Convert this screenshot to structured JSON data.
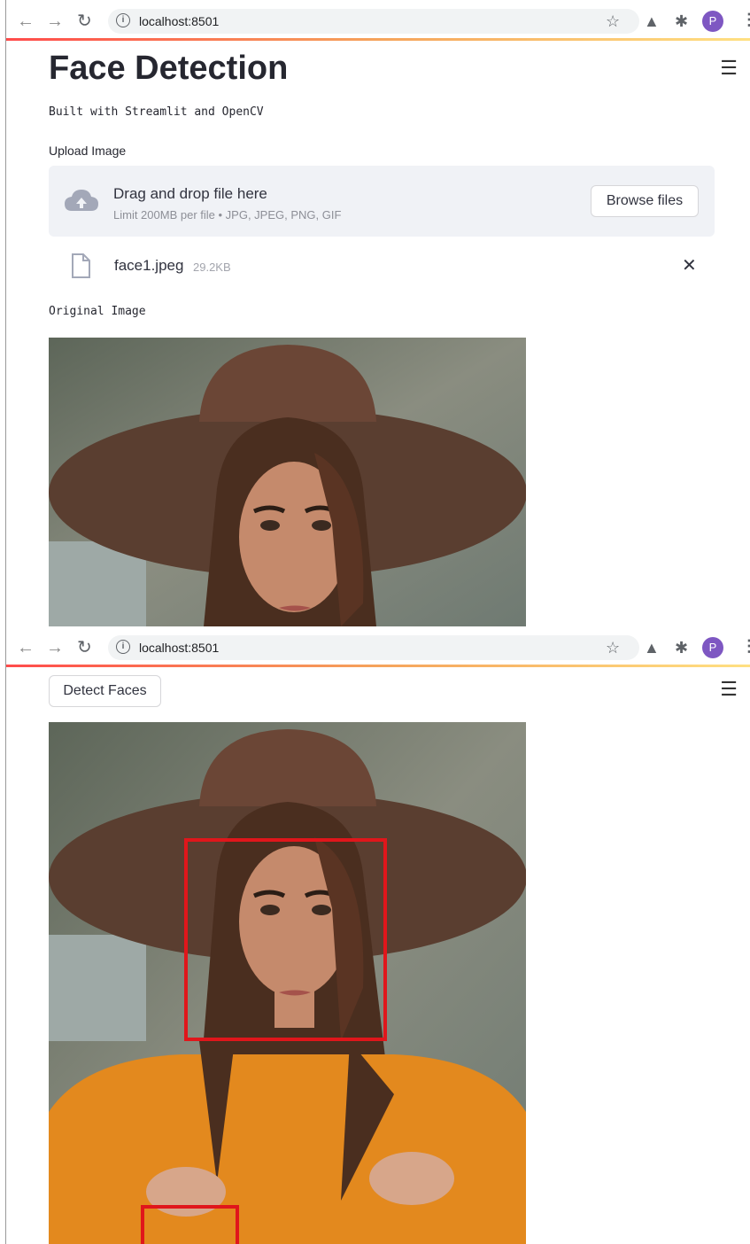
{
  "browser": {
    "url": "localhost:8501",
    "avatar_letter": "P"
  },
  "app": {
    "title": "Face Detection",
    "subtitle": "Built with Streamlit and OpenCV",
    "uploader": {
      "label": "Upload Image",
      "drag_text": "Drag and drop file here",
      "limit_text": "Limit 200MB per file • JPG, JPEG, PNG, GIF",
      "browse_label": "Browse files"
    },
    "file": {
      "name": "face1.jpeg",
      "size": "29.2KB"
    },
    "original_label": "Original Image",
    "detect_label": "Detect Faces"
  },
  "colors": {
    "accent_start": "#ff4b4b",
    "accent_end": "#ffe082",
    "detection_box": "#e0161b",
    "avatar": "#7e57c2"
  }
}
